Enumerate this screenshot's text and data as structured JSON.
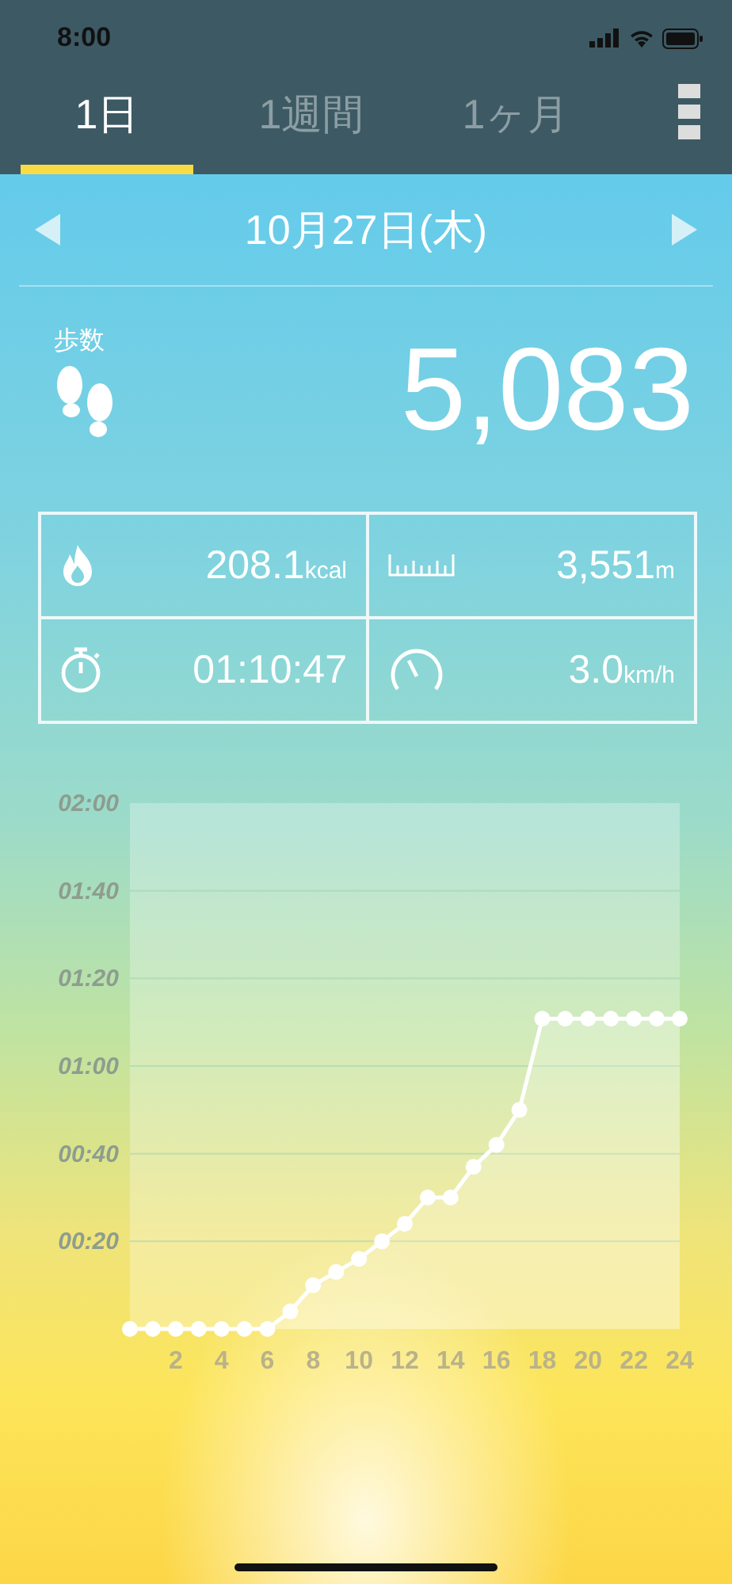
{
  "status_bar": {
    "time": "8:00"
  },
  "tabs": [
    {
      "label": "1日",
      "selected": true
    },
    {
      "label": "1週間",
      "selected": false
    },
    {
      "label": "1ヶ月",
      "selected": false
    }
  ],
  "date": "10月27日(木)",
  "steps": {
    "label": "歩数",
    "value": "5,083"
  },
  "stats": [
    {
      "kind": "calories",
      "value": "208.1",
      "unit": "kcal"
    },
    {
      "kind": "distance",
      "value": "3,551",
      "unit": "m"
    },
    {
      "kind": "duration",
      "value": "01:10:47"
    },
    {
      "kind": "speed",
      "value": "3.0",
      "unit": "km/h"
    }
  ],
  "chart_data": {
    "type": "line",
    "grid": true,
    "xlim": [
      0,
      24
    ],
    "ylim": [
      0,
      120
    ],
    "x": [
      0,
      1,
      2,
      3,
      4,
      5,
      6,
      7,
      8,
      9,
      10,
      11,
      12,
      13,
      14,
      15,
      16,
      17,
      18,
      19,
      20,
      21,
      22,
      23,
      24
    ],
    "series": [
      {
        "color": "#ffffff",
        "marker": true,
        "values": [
          0,
          0,
          0,
          0,
          0,
          0,
          0,
          4,
          10,
          13,
          16,
          20,
          24,
          30,
          30,
          37,
          42,
          50,
          70.8,
          70.8,
          70.8,
          70.8,
          70.8,
          70.8,
          70.8
        ]
      }
    ],
    "xticks": [
      2,
      4,
      6,
      8,
      10,
      12,
      14,
      16,
      18,
      20,
      22,
      24
    ],
    "yticks": [
      {
        "value": 20,
        "label": "00:20"
      },
      {
        "value": 40,
        "label": "00:40"
      },
      {
        "value": 60,
        "label": "01:00"
      },
      {
        "value": 80,
        "label": "01:20"
      },
      {
        "value": 100,
        "label": "01:40"
      },
      {
        "value": 120,
        "label": "02:00"
      }
    ]
  }
}
